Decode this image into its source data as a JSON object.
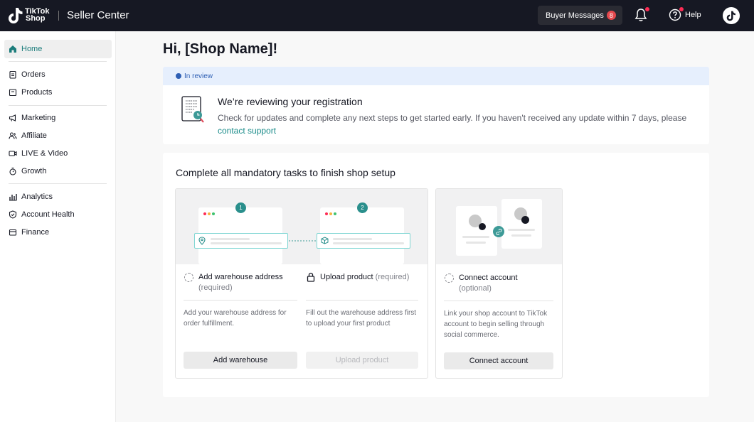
{
  "topbar": {
    "logo_line1": "TikTok",
    "logo_line2": "Shop",
    "title": "Seller Center",
    "buyer_messages_label": "Buyer Messages",
    "buyer_messages_count": "8",
    "help_label": "Help"
  },
  "sidebar": {
    "items": [
      {
        "label": "Home",
        "icon": "home-icon",
        "active": true
      },
      {
        "label": "Orders",
        "icon": "clipboard-icon"
      },
      {
        "label": "Products",
        "icon": "box-icon"
      },
      {
        "label": "Marketing",
        "icon": "megaphone-icon"
      },
      {
        "label": "Affiliate",
        "icon": "users-icon"
      },
      {
        "label": "LIVE & Video",
        "icon": "video-icon"
      },
      {
        "label": "Growth",
        "icon": "stopwatch-icon"
      },
      {
        "label": "Analytics",
        "icon": "bar-chart-icon"
      },
      {
        "label": "Account Health",
        "icon": "shield-icon"
      },
      {
        "label": "Finance",
        "icon": "wallet-icon"
      }
    ]
  },
  "main": {
    "greeting": "Hi, [Shop Name]!",
    "review": {
      "status": "In review",
      "title": "We’re reviewing your registration",
      "text": "Check for updates and complete any next steps to get started early. If you haven't received any update within 7 days, please",
      "link": "contact support"
    },
    "tasks": {
      "title": "Complete all mandatory tasks to finish shop setup",
      "warehouse": {
        "step": "1",
        "label": "Add warehouse address",
        "req": "(required)",
        "desc": "Add your warehouse address for order fulfillment.",
        "button": "Add warehouse"
      },
      "product": {
        "step": "2",
        "label": "Upload product",
        "req": "(required)",
        "desc": "Fill out the warehouse address first to upload your first product",
        "button": "Upload product"
      },
      "connect": {
        "label": "Connect account",
        "req": "(optional)",
        "desc": "Link your shop account to TikTok account to begin selling through social commerce.",
        "button": "Connect account"
      }
    }
  },
  "colors": {
    "topbar": "#161823",
    "accent": "#1b7c7b",
    "review_bg": "#e6effd",
    "badge": "#e5484d"
  }
}
